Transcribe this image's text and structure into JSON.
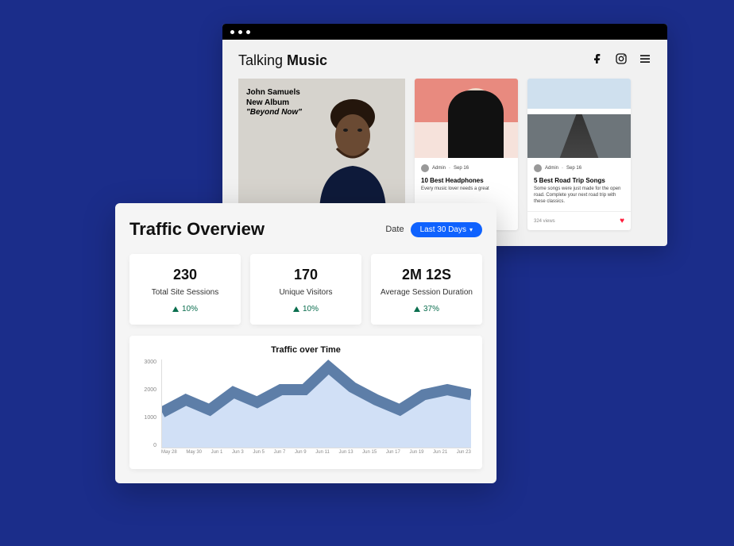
{
  "site": {
    "brand_a": "Talking ",
    "brand_b": "Music",
    "hero": {
      "line1": "John Samuels",
      "line2": "New Album",
      "line3": "\"Beyond Now\""
    },
    "cards": [
      {
        "author": "Admin",
        "date": "Sep 16",
        "title": "10 Best Headphones",
        "desc": "Every music lover needs a great"
      },
      {
        "author": "Admin",
        "date": "Sep 16",
        "title": "5 Best Road Trip Songs",
        "desc": "Some songs were just made for the open road. Complete your next road trip with these classics.",
        "footer_left": "324 views"
      }
    ]
  },
  "analytics": {
    "title": "Traffic Overview",
    "date_label": "Date",
    "date_range": "Last 30 Days",
    "stats": [
      {
        "value": "230",
        "label": "Total Site Sessions",
        "trend": "10%"
      },
      {
        "value": "170",
        "label": "Unique Visitors",
        "trend": "10%"
      },
      {
        "value": "2M 12S",
        "label": "Average Session Duration",
        "trend": "37%"
      }
    ],
    "chart_title": "Traffic over Time"
  },
  "chart_data": {
    "type": "area",
    "xlabel": "",
    "ylabel": "",
    "ylim": [
      0,
      3500
    ],
    "y_ticks": [
      "3000",
      "2000",
      "1000",
      "0"
    ],
    "categories": [
      "May 28",
      "May 30",
      "Jun 1",
      "Jun 3",
      "Jun 5",
      "Jun 7",
      "Jun 9",
      "Jun 11",
      "Jun 13",
      "Jun 15",
      "Jun 17",
      "Jun 19",
      "Jun 21",
      "Jun 23"
    ],
    "values": [
      1400,
      1900,
      1500,
      2200,
      1800,
      2300,
      2300,
      3200,
      2400,
      1900,
      1500,
      2100,
      2300,
      2100
    ]
  }
}
